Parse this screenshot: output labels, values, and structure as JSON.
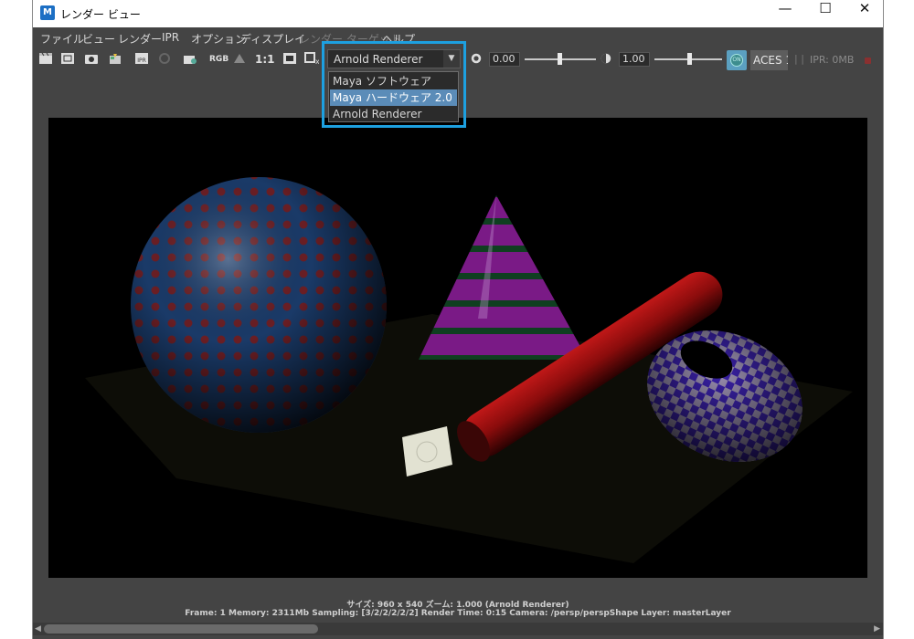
{
  "window": {
    "title": "レンダー ビュー",
    "app_icon": "M",
    "min_icon": "—",
    "max_icon": "☐",
    "close_icon": "✕"
  },
  "menu": [
    {
      "label": "ファイル",
      "enabled": true
    },
    {
      "label": "ビュー",
      "enabled": true
    },
    {
      "label": "レンダー",
      "enabled": true
    },
    {
      "label": "IPR",
      "enabled": true
    },
    {
      "label": "オプション",
      "enabled": true
    },
    {
      "label": "ディスプレイ",
      "enabled": true
    },
    {
      "label": "レンダー ターゲット",
      "enabled": false
    },
    {
      "label": "ヘルプ",
      "enabled": true
    }
  ],
  "toolbar": {
    "rgb_label": "RGB",
    "one_to_one_label": "1:1",
    "renderer_value": "Arnold Renderer",
    "exposure_value": "0.00",
    "gamma_value": "1.00",
    "colormgmt_label": "ACES 1",
    "ipr_separator": "| |",
    "ipr_memory": "IPR: 0MB"
  },
  "renderer_dropdown": {
    "options": [
      {
        "label": "Maya ソフトウェア",
        "selected": false
      },
      {
        "label": "Maya ハードウェア 2.0",
        "selected": true
      },
      {
        "label": "Arnold Renderer",
        "selected": false
      }
    ]
  },
  "status": {
    "line1": "サイズ: 960 x 540 ズーム: 1.000    (Arnold Renderer)",
    "line2": "Frame: 1    Memory: 2311Mb    Sampling: [3/2/2/2/2/2]    Render Time: 0:15    Camera: /persp/perspShape    Layer: masterLayer"
  },
  "colors": {
    "highlight": "#1da0e0",
    "selection": "#5b8cb8",
    "panel": "#444444"
  }
}
